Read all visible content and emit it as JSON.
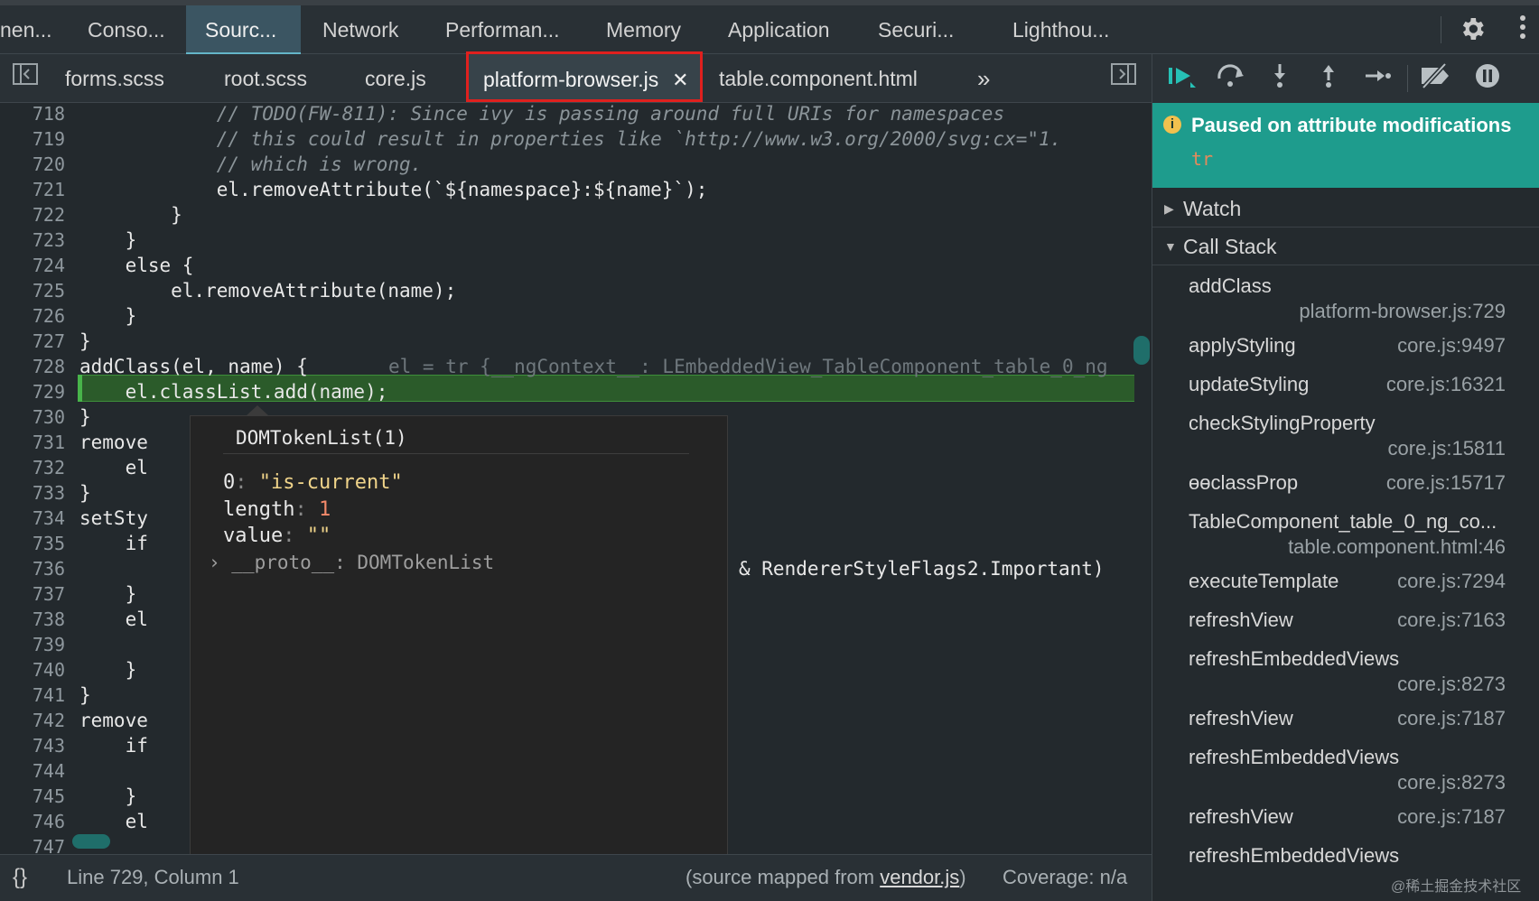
{
  "main_tabs": [
    {
      "label": "nen..."
    },
    {
      "label": "Conso..."
    },
    {
      "label": "Sourc..."
    },
    {
      "label": "Network"
    },
    {
      "label": "Performan..."
    },
    {
      "label": "Memory"
    },
    {
      "label": "Application"
    },
    {
      "label": "Securi..."
    },
    {
      "label": "Lighthou..."
    }
  ],
  "main_tabs_active": "Sourc...",
  "file_tabs": [
    {
      "label": "forms.scss"
    },
    {
      "label": "root.scss"
    },
    {
      "label": "core.js"
    },
    {
      "label": "platform-browser.js"
    },
    {
      "label": "table.component.html"
    }
  ],
  "file_tabs_active": "platform-browser.js",
  "icons": {
    "settings": "gear-icon",
    "more": "kebab-icon",
    "navigator": "sidebar-toggle-icon",
    "overflow": "double-chevron-icon",
    "debugger_toggle": "sidebar-toggle-icon",
    "close": "close-icon"
  },
  "code": {
    "line_numbers": [
      "718",
      "719",
      "720",
      "721",
      "722",
      "723",
      "724",
      "725",
      "726",
      "727",
      "728",
      "729",
      "730",
      "731",
      "732",
      "733",
      "734",
      "735",
      "736",
      "737",
      "738",
      "739",
      "740",
      "741",
      "742",
      "743",
      "744",
      "745",
      "746",
      "747"
    ],
    "lines": [
      "            // TODO(FW-811): Since ivy is passing around full URIs for namespaces",
      "            // this could result in properties like `http://www.w3.org/2000/svg:cx=\"1.",
      "            // which is wrong.",
      "            el.removeAttribute(`${namespace}:${name}`);",
      "        }",
      "    }",
      "    else {",
      "        el.removeAttribute(name);",
      "    }",
      "}",
      "addClass(el, name) {",
      "    el.classList.add(name);",
      "}",
      "remove",
      "    el",
      "}",
      "setSty",
      "    if",
      "",
      "    }",
      "    el",
      "",
      "    }",
      "}",
      "remove",
      "    if",
      "",
      "    }",
      "    el",
      ""
    ],
    "inline_value": "el = tr {__ngContext__: LEmbeddedView_TableComponent_table_0_ng",
    "line_736_tail": "& RendererStyleFlags2.Important)",
    "paused_line": "729"
  },
  "popover": {
    "title": "DOMTokenList(1)",
    "entries": [
      {
        "key": "0",
        "value": "\"is-current\"",
        "kind": "string"
      },
      {
        "key": "length",
        "value": "1",
        "kind": "number"
      },
      {
        "key": "value",
        "value": "\"\"",
        "kind": "string"
      }
    ],
    "proto_key": "__proto__",
    "proto_value": "DOMTokenList"
  },
  "status": {
    "braces": "{}",
    "position": "Line 729, Column 1",
    "source_mapped_prefix": "(source mapped from ",
    "source_mapped_file": "vendor.js",
    "source_mapped_suffix": ")",
    "coverage": "Coverage: n/a"
  },
  "debugger": {
    "paused_message": "Paused on attribute modifications",
    "paused_node": "tr",
    "sections": {
      "watch": "Watch",
      "call_stack": "Call Stack"
    },
    "call_stack": [
      {
        "fn": "addClass",
        "loc": "platform-browser.js:729",
        "wrap": true
      },
      {
        "fn": "applyStyling",
        "loc": "core.js:9497",
        "wrap": false
      },
      {
        "fn": "updateStyling",
        "loc": "core.js:16321",
        "wrap": false
      },
      {
        "fn": "checkStylingProperty",
        "loc": "core.js:15811",
        "wrap": true
      },
      {
        "fn": "ɵɵclassProp",
        "loc": "core.js:15717",
        "wrap": false
      },
      {
        "fn": "TableComponent_table_0_ng_co...",
        "loc": "table.component.html:46",
        "wrap": true
      },
      {
        "fn": "executeTemplate",
        "loc": "core.js:7294",
        "wrap": false
      },
      {
        "fn": "refreshView",
        "loc": "core.js:7163",
        "wrap": false
      },
      {
        "fn": "refreshEmbeddedViews",
        "loc": "core.js:8273",
        "wrap": true
      },
      {
        "fn": "refreshView",
        "loc": "core.js:7187",
        "wrap": false
      },
      {
        "fn": "refreshEmbeddedViews",
        "loc": "core.js:8273",
        "wrap": true
      },
      {
        "fn": "refreshView",
        "loc": "core.js:7187",
        "wrap": false
      },
      {
        "fn": "refreshEmbeddedViews",
        "loc": "",
        "wrap": false
      }
    ]
  },
  "watermark": "@稀土掘金技术社区"
}
